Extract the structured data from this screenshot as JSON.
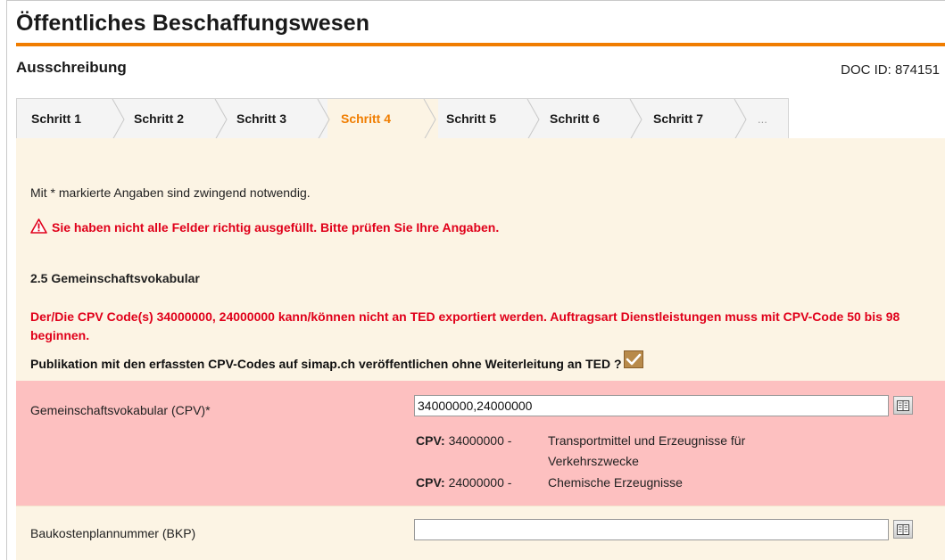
{
  "header": {
    "title": "Öffentliches Beschaffungswesen",
    "subtitle": "Ausschreibung",
    "doc_id": "DOC ID: 874151"
  },
  "tabs": [
    {
      "label": "Schritt 1",
      "active": false
    },
    {
      "label": "Schritt 2",
      "active": false
    },
    {
      "label": "Schritt 3",
      "active": false
    },
    {
      "label": "Schritt 4",
      "active": true
    },
    {
      "label": "Schritt 5",
      "active": false
    },
    {
      "label": "Schritt 6",
      "active": false
    },
    {
      "label": "Schritt 7",
      "active": false
    },
    {
      "label": "...",
      "active": false
    }
  ],
  "form": {
    "required_note": "Mit * markierte Angaben sind zwingend notwendig.",
    "error_summary": "Sie haben nicht alle Felder richtig ausgefüllt. Bitte prüfen Sie Ihre Angaben.",
    "section_title": "2.5 Gemeinschaftsvokabular",
    "cpv_error": "Der/Die CPV Code(s) 34000000, 24000000 kann/können nicht an TED exportiert werden. Auftragsart Dienstleistungen muss mit CPV-Code 50 bis 98 beginnen.",
    "publish_question": "Publikation mit den erfassten CPV-Codes auf simap.ch veröffentlichen ohne Weiterleitung an TED ?",
    "publish_checked": true,
    "cpv_label": "Gemeinschaftsvokabular (CPV)*",
    "cpv_value": "34000000,24000000",
    "cpv_entries": [
      {
        "prefix": "CPV:",
        "code": "34000000 -",
        "description": "Transportmittel und Erzeugnisse für",
        "description2": "Verkehrszwecke"
      },
      {
        "prefix": "CPV:",
        "code": "24000000 -",
        "description": "Chemische Erzeugnisse",
        "description2": ""
      }
    ],
    "bkp_label": "Baukostenplannummer (BKP)",
    "bkp_value": ""
  },
  "colors": {
    "accent": "#f07d00",
    "error": "#e0001a",
    "panel_bg": "#fcf4e4",
    "error_row_bg": "#fdc0c0"
  },
  "icons": {
    "warning": "warning-triangle-icon",
    "book": "book-icon",
    "check": "checkmark-icon"
  }
}
